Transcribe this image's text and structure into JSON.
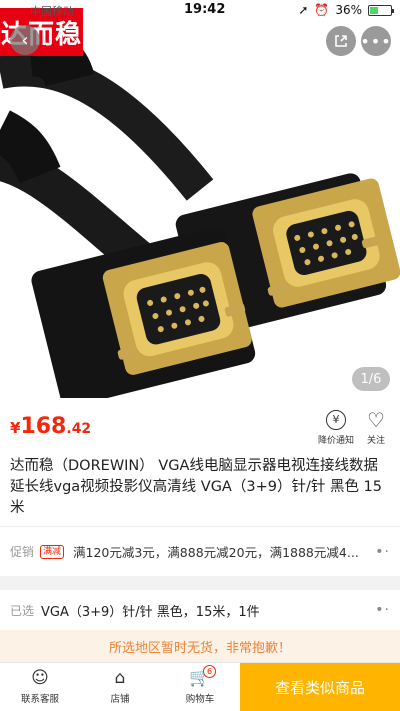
{
  "status_bar": {
    "carrier": "中国移动",
    "time": "19:42",
    "battery": "36%",
    "battery_level": 0.36
  },
  "hero": {
    "brand_logo": "达而稳",
    "image_counter": "1/6",
    "image_icon": "vga-cable-product-photo"
  },
  "price": {
    "symbol": "¥",
    "integer": "168",
    "decimal": ".42"
  },
  "actions": {
    "price_notice": "降价通知",
    "price_notice_icon": "¥",
    "follow": "关注"
  },
  "title": "达而稳（DOREWIN） VGA线电脑显示器电视连接线数据延长线vga视频投影仪高清线 VGA（3+9）针/针 黑色 15米",
  "promo": {
    "label": "促销",
    "tag": "满减",
    "text": "满120元减3元，满888元减20元，满1888元减4..."
  },
  "selected": {
    "label": "已选",
    "value": "VGA（3+9）针/针  黑色，15米，1件"
  },
  "warning": "所选地区暂时无货，非常抱歉！",
  "bottom_bar": {
    "service": "联系客服",
    "store": "店铺",
    "cart": "购物车",
    "cart_count": "6",
    "similar": "查看类似商品"
  },
  "colors": {
    "accent": "#f2270c",
    "button": "#ffb400",
    "brand": "#e60012"
  }
}
